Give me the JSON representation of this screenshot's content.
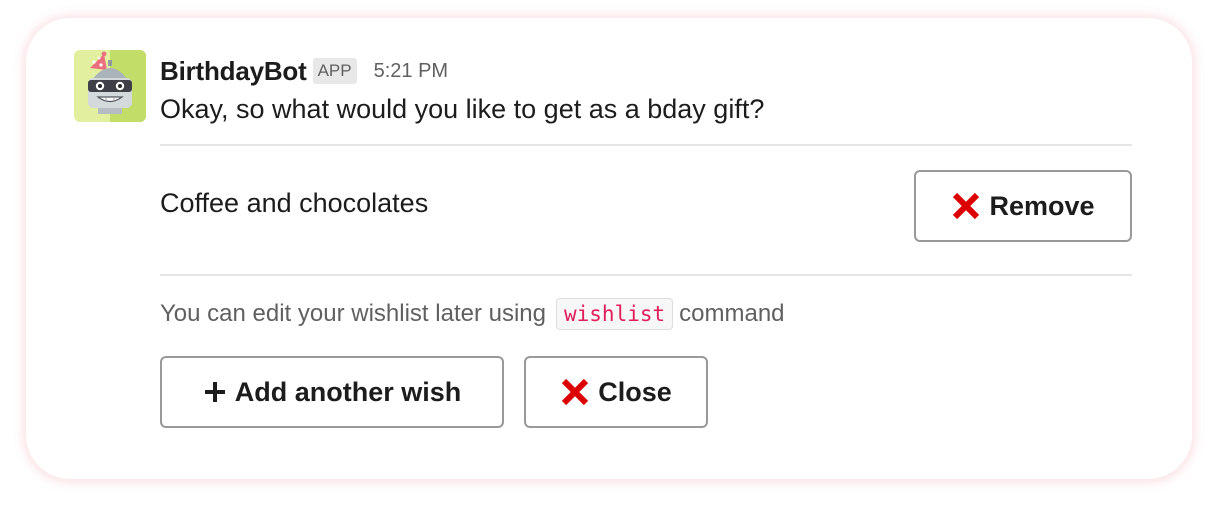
{
  "bot": {
    "name": "BirthdayBot",
    "badge": "APP",
    "timestamp": "5:21 PM",
    "avatar_icon": "robot-party-hat-icon"
  },
  "message": {
    "text": "Okay, so what would you like to get as a bday gift?"
  },
  "wish": {
    "text": "Coffee and chocolates",
    "remove_label": "Remove",
    "remove_icon": "red-x-icon"
  },
  "hint": {
    "prefix": "You can edit your wishlist later using",
    "command": "wishlist",
    "suffix": "command"
  },
  "actions": {
    "add_label": "Add another wish",
    "add_icon": "plus-icon",
    "close_label": "Close",
    "close_icon": "red-x-icon"
  },
  "colors": {
    "accent_red": "#dd0000",
    "code_text": "#e01e5a",
    "card_glow": "#f0a0aa",
    "avatar_bg": "#c8e07a"
  }
}
